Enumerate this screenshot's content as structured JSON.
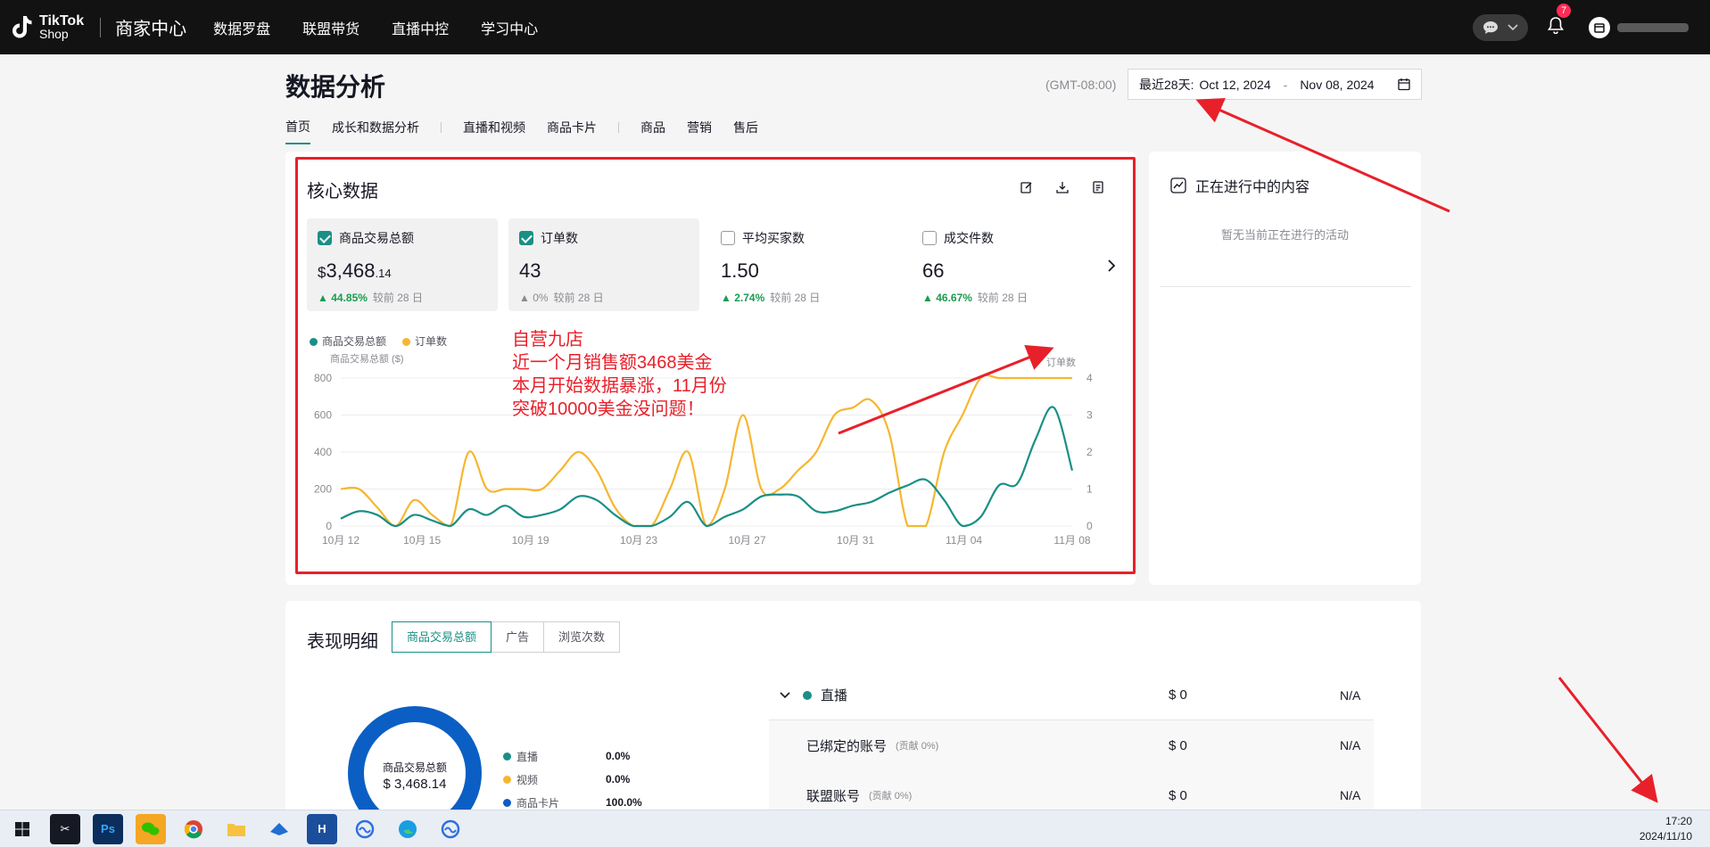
{
  "topbar": {
    "logo_line1": "TikTok",
    "logo_line2": "Shop",
    "brand": "商家中心",
    "nav": [
      "数据罗盘",
      "联盟带货",
      "直播中控",
      "学习中心"
    ],
    "notification_count": "7"
  },
  "page": {
    "title": "数据分析",
    "timezone": "(GMT-08:00)",
    "date_range_label": "最近28天:",
    "date_start": "Oct 12, 2024",
    "date_end": "Nov 08, 2024",
    "tabs": [
      "首页",
      "成长和数据分析",
      "直播和视频",
      "商品卡片",
      "商品",
      "营销",
      "售后"
    ]
  },
  "core": {
    "title": "核心数据",
    "metrics": [
      {
        "label": "商品交易总额",
        "currency": "$",
        "value_main": "3,468",
        "value_dec": ".14",
        "change": "44.85%",
        "compare": "较前 28 日",
        "checked": true
      },
      {
        "label": "订单数",
        "currency": "",
        "value_main": "43",
        "value_dec": "",
        "change": "0%",
        "compare": "较前 28 日",
        "checked": true
      },
      {
        "label": "平均买家数",
        "currency": "",
        "value_main": "1.50",
        "value_dec": "",
        "change": "2.74%",
        "compare": "较前 28 日",
        "checked": false
      },
      {
        "label": "成交件数",
        "currency": "",
        "value_main": "66",
        "value_dec": "",
        "change": "46.67%",
        "compare": "较前 28 日",
        "checked": false
      }
    ],
    "overlay_lines": [
      "自营九店",
      "近一个月销售额3468美金",
      "本月开始数据暴涨，11月份",
      "突破10000美金没问题！"
    ]
  },
  "chart_data": {
    "type": "line",
    "legend": [
      "商品交易总额",
      "订单数"
    ],
    "left_axis_label": "商品交易总额 ($)",
    "right_axis_label": "订单数",
    "left_ticks": [
      "800",
      "600",
      "400",
      "200",
      "0"
    ],
    "right_ticks": [
      "4",
      "3",
      "2",
      "1",
      "0"
    ],
    "ylim_left": [
      0,
      800
    ],
    "ylim_right": [
      0,
      4
    ],
    "x_tick_labels": [
      "10月 12",
      "10月 15",
      "10月 19",
      "10月 23",
      "10月 27",
      "10月 31",
      "11月 04",
      "11月 08"
    ],
    "x_tick_index": [
      0,
      3,
      7,
      11,
      15,
      19,
      23,
      27
    ],
    "colors": {
      "gmv": "#1a8f85",
      "orders": "#f5b731"
    },
    "series": [
      {
        "name": "商品交易总额",
        "axis": "left",
        "values": [
          40,
          80,
          60,
          0,
          60,
          30,
          0,
          90,
          60,
          110,
          50,
          60,
          90,
          160,
          140,
          60,
          0,
          0,
          50,
          130,
          0,
          50,
          90,
          160,
          170,
          160,
          80,
          80,
          110,
          130,
          180,
          220,
          250,
          140,
          0,
          50,
          220,
          230,
          470,
          640,
          300
        ]
      },
      {
        "name": "订单数",
        "axis": "right",
        "values": [
          1,
          1,
          0.5,
          0,
          0.7,
          0.3,
          0,
          2,
          1,
          1,
          1,
          1,
          1.5,
          2,
          1.5,
          0.5,
          0,
          0,
          1,
          2,
          0,
          1,
          3,
          1,
          1,
          1.5,
          2,
          3,
          3.2,
          3.4,
          2.5,
          0,
          0,
          2,
          3,
          4,
          4,
          4,
          4,
          4,
          4
        ]
      }
    ]
  },
  "in_progress": {
    "title": "正在进行中的内容",
    "empty_text": "暂无当前正在进行的活动"
  },
  "performance": {
    "title": "表现明细",
    "tabs": [
      "商品交易总额",
      "广告",
      "浏览次数"
    ],
    "donut_label": "商品交易总额",
    "donut_value": "$ 3,468.14",
    "legend": [
      {
        "name": "直播",
        "pct": "0.0%",
        "color": "#1a8f85"
      },
      {
        "name": "视频",
        "pct": "0.0%",
        "color": "#f5b731"
      },
      {
        "name": "商品卡片",
        "pct": "100.0%",
        "color": "#0b5fc4"
      }
    ],
    "rows": [
      {
        "name": "直播",
        "contrib": "",
        "value": "$ 0",
        "extra": "N/A"
      },
      {
        "name": "已绑定的账号",
        "contrib": "(贡献 0%)",
        "value": "$ 0",
        "extra": "N/A"
      },
      {
        "name": "联盟账号",
        "contrib": "(贡献 0%)",
        "value": "$ 0",
        "extra": "N/A"
      }
    ]
  },
  "taskbar": {
    "time": "17:20",
    "date": "2024/11/10",
    "apps": [
      "start",
      "capcut",
      "photoshop",
      "wechat",
      "chrome",
      "files",
      "app-blue",
      "h-app",
      "app-wave",
      "edge",
      "app-wave2"
    ]
  }
}
